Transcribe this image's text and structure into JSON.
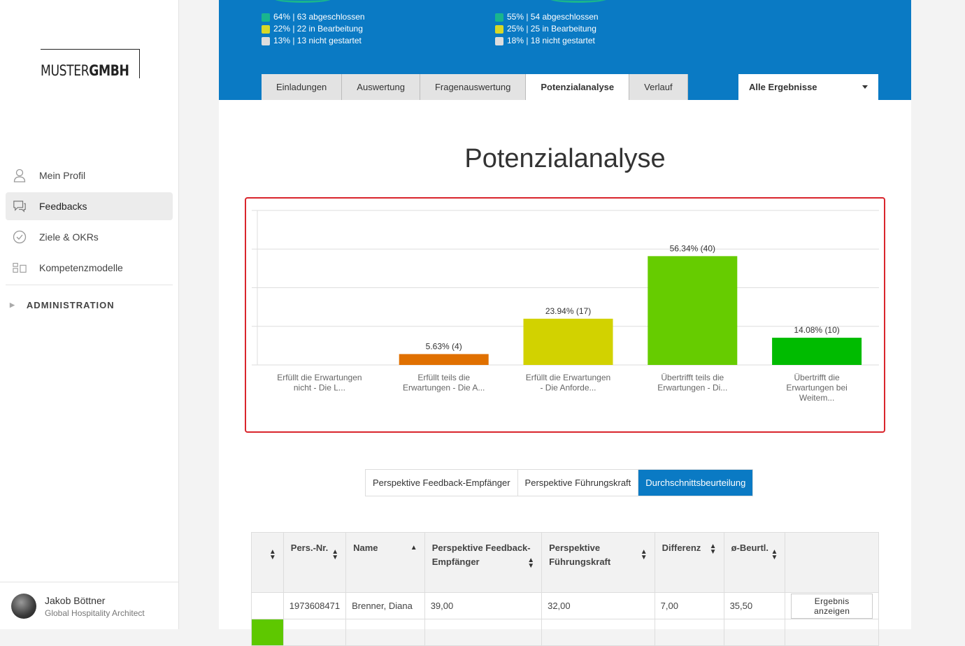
{
  "sidebar": {
    "logo": {
      "light": "MUSTER",
      "bold": "GMBH"
    },
    "items": [
      {
        "label": "Mein Profil",
        "icon": "user-icon"
      },
      {
        "label": "Feedbacks",
        "icon": "chat-icon"
      },
      {
        "label": "Ziele & OKRs",
        "icon": "check-circle-icon"
      },
      {
        "label": "Kompetenzmodelle",
        "icon": "model-icon"
      }
    ],
    "admin": "ADMINISTRATION",
    "user": {
      "name": "Jakob Böttner",
      "role": "Global Hospitality Architect"
    }
  },
  "header": {
    "stats_left": [
      "64% | 63 abgeschlossen",
      "22% | 22 in Bearbeitung",
      "13% | 13 nicht gestartet"
    ],
    "stats_right": [
      "55% | 54 abgeschlossen",
      "25% | 25 in Bearbeitung",
      "18% | 18 nicht gestartet"
    ],
    "status_colors": [
      "#19b58e",
      "#d8d827",
      "#dddddd"
    ],
    "tabs": [
      "Einladungen",
      "Auswertung",
      "Fragenauswertung",
      "Potenzialanalyse",
      "Verlauf"
    ],
    "active_tab": "Potenzialanalyse",
    "filter": "Alle Ergebnisse"
  },
  "page_title": "Potenzialanalyse",
  "chart_data": {
    "type": "bar",
    "categories": [
      [
        "Erfüllt die Erwartungen",
        "nicht - Die L..."
      ],
      [
        "Erfüllt teils die",
        "Erwartungen - Die A..."
      ],
      [
        "Erfüllt die Erwartungen",
        "- Die Anforde..."
      ],
      [
        "Übertrifft teils die",
        "Erwartungen - Di..."
      ],
      [
        "Übertrifft die",
        "Erwartungen bei",
        "Weitem..."
      ]
    ],
    "values": [
      0,
      5.63,
      23.94,
      56.34,
      14.08
    ],
    "data_labels": [
      "",
      "5.63% (4)",
      "23.94% (17)",
      "56.34% (40)",
      "14.08% (10)"
    ],
    "colors": [
      "#e74c3c",
      "#e07000",
      "#d2d200",
      "#66cc00",
      "#00bb00"
    ],
    "ylim": [
      0,
      80
    ],
    "grid": true
  },
  "perspectives": [
    "Perspektive Feedback-Empfänger",
    "Perspektive Führungskraft",
    "Durchschnittsbeurteilung"
  ],
  "active_perspective": "Durchschnittsbeurteilung",
  "table": {
    "headers": [
      "",
      "Pers.-Nr.",
      "Name",
      "Perspektive Feedback-Empfänger",
      "Perspektive Führungskraft",
      "Differenz",
      "ø-Beurtl.",
      ""
    ],
    "rows": [
      {
        "nr": "1973608471",
        "name": "Brenner, Diana",
        "fe": "39,00",
        "fk": "32,00",
        "diff": "7,00",
        "avg": "35,50",
        "action": "Ergebnis anzeigen"
      }
    ]
  }
}
